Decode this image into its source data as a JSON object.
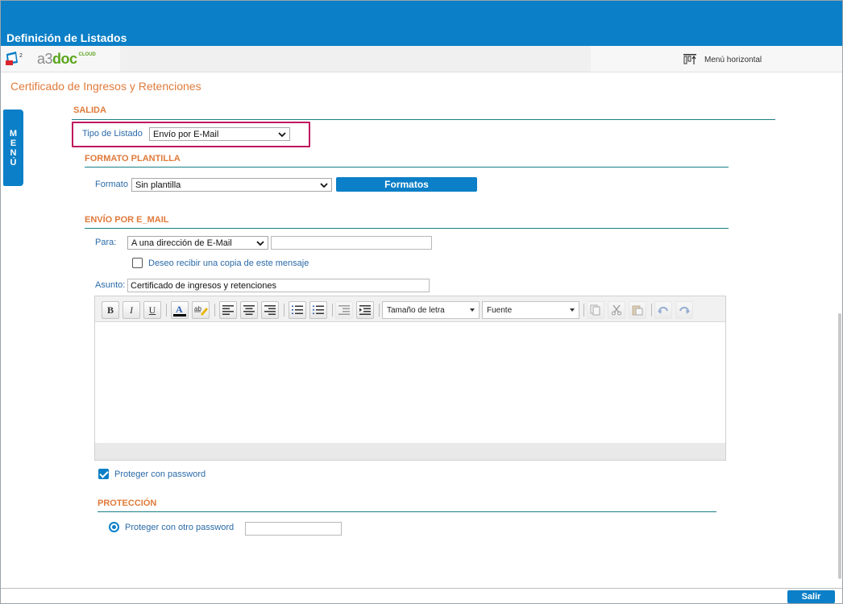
{
  "window": {
    "title": "Definición de Listados"
  },
  "appbar": {
    "brand_a3": "a3",
    "brand_doc": "doc",
    "brand_cloud": "CLOUD",
    "menu_horizontal_label": "Menú horizontal"
  },
  "page": {
    "title": "Certificado de Ingresos y Retenciones"
  },
  "side_menu": {
    "letters": [
      "M",
      "E",
      "N",
      "Ú"
    ]
  },
  "salida": {
    "section_title": "SALIDA",
    "tipo_label": "Tipo de Listado",
    "tipo_value": "Envío por E-Mail"
  },
  "formato_plantilla": {
    "section_title": "FORMATO PLANTILLA",
    "formato_label": "Formato",
    "formato_value": "Sin plantilla",
    "formatos_button": "Formatos"
  },
  "envio_email": {
    "section_title": "ENVÍO POR E_MAIL",
    "para_label": "Para:",
    "para_value": "A una dirección de E-Mail",
    "para_input": "",
    "copia_label": "Deseo recibir una copia de este mensaje",
    "copia_checked": false,
    "asunto_label": "Asunto:",
    "asunto_value": "Certificado de ingresos y retenciones"
  },
  "editor": {
    "font_size_label": "Tamaño de letra",
    "font_label": "Fuente",
    "bold": "B",
    "italic": "I",
    "underline": "U",
    "text_color_glyph": "A",
    "highlight_glyph": "ab",
    "body": ""
  },
  "proteger": {
    "label": "Proteger con password",
    "checked": true
  },
  "proteccion": {
    "section_title": "PROTECCIÓN",
    "radio_label": "Proteger con otro password",
    "password_value": ""
  },
  "footer": {
    "salir_button": "Salir"
  },
  "colors": {
    "accent_blue": "#0b7fc7",
    "section_orange": "#e07a3a",
    "label_blue": "#2a6aa8",
    "highlight_magenta": "#c0185d",
    "brand_green": "#5aa51e"
  }
}
